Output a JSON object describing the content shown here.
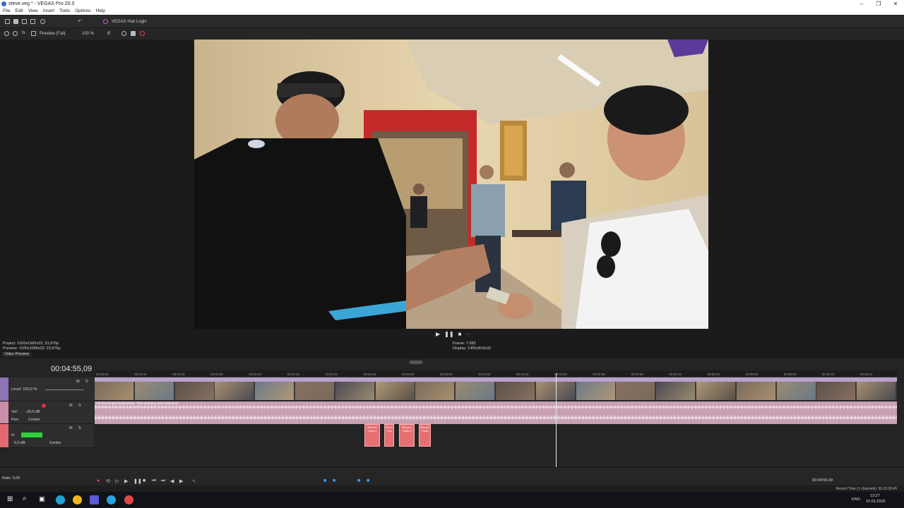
{
  "window": {
    "title": "steve.veg * - VEGAS Pro 20.0",
    "min": "–",
    "max": "❐",
    "close": "✕"
  },
  "menu": [
    "File",
    "Edit",
    "View",
    "Insert",
    "Tools",
    "Options",
    "Help"
  ],
  "toolbar": {
    "hub_login": "VEGAS Hub Login"
  },
  "preview_toolbar": {
    "quality": "Preview (Full)",
    "zoom": "100 %"
  },
  "preview_info": {
    "project": "Project:  1920x1080x32; 23,976p",
    "preview": "Preview:  1920x1080x32; 23,976p",
    "frame": "Frame:     7.082",
    "display": "Display:   1456x819x32",
    "tab": "Video Preview"
  },
  "timeline": {
    "timecode": "00:04:55,09",
    "ruler_ticks": [
      "00:04:32",
      "00:04:34",
      "00:04:36",
      "00:04:38",
      "00:04:40",
      "00:04:42",
      "00:04:44",
      "00:04:46",
      "00:04:48",
      "00:04:50",
      "00:04:52",
      "00:04:54",
      "00:04:56",
      "00:04:58",
      "00:05:00",
      "00:05:02",
      "00:05:04",
      "00:05:06",
      "00:05:08",
      "00:05:10",
      "00:05:12"
    ],
    "video_track": {
      "level": "Level: 100,0 %",
      "m": "M",
      "s": "S",
      "clip_title": "Finding Empty Restaurants, Then Bringing 100 Customers"
    },
    "audio_track": {
      "vol": "Vol:",
      "vol_value": "-20,0 dB",
      "pan": "Pan:",
      "pan_value": "Center",
      "m": "M",
      "s": "S",
      "clip_title": "Finding Empty Restaurants, Then Bringing 100 Customers"
    },
    "rec_track": {
      "in": "In",
      "db": "0,0 dB",
      "center": "Center",
      "m": "M",
      "s": "S"
    },
    "rec_clips": [
      "Record Track 1",
      "Reco Trac",
      "Record Track 3",
      "Record Track"
    ],
    "rate": "Rate: 0,00",
    "end_time": "00:04:55,09",
    "record_time": "Record Time (1 channels): 55:23:16:45"
  },
  "taskbar": {
    "lang": "ENG",
    "time": "13:27",
    "date": "15.01.2026"
  }
}
